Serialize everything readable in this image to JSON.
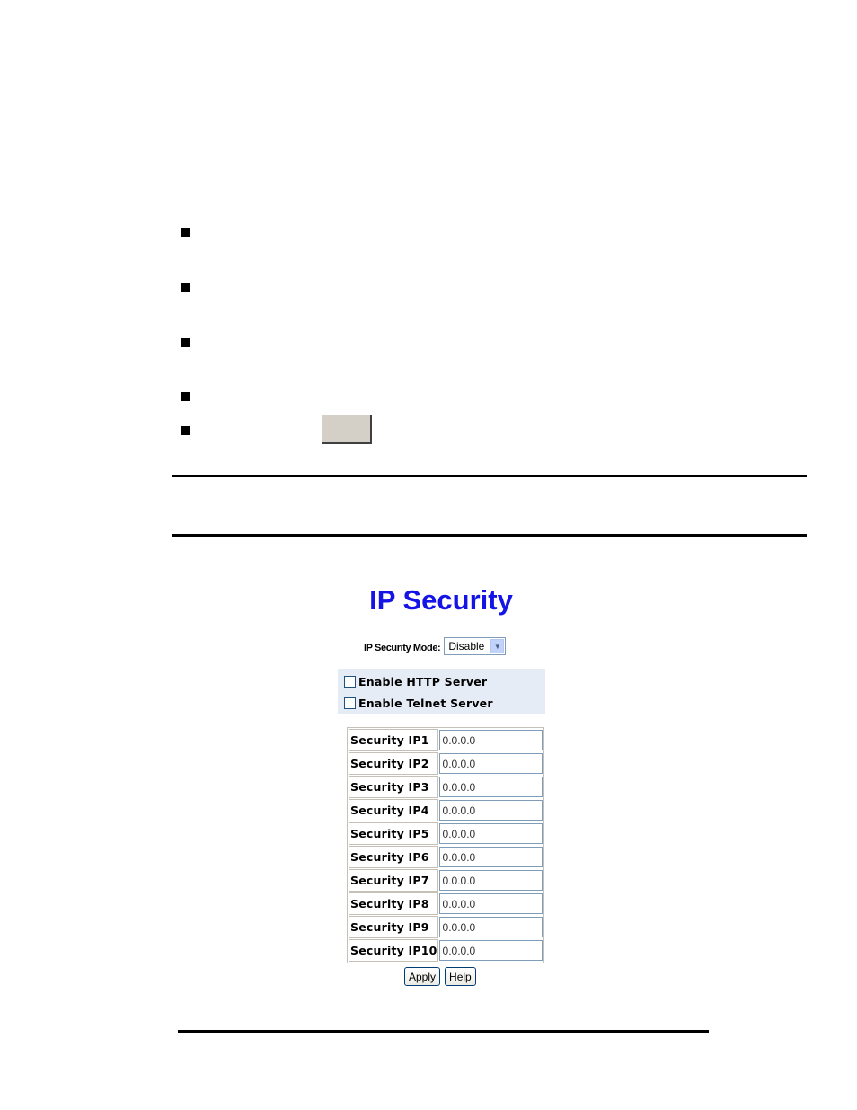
{
  "document": {
    "bullet_count": 5,
    "inline_button": {
      "label": ""
    }
  },
  "panel": {
    "title": "IP Security",
    "mode": {
      "label": "IP Security Mode:",
      "selected": "Disable",
      "icon": "chevron-down-icon"
    },
    "services": [
      {
        "label": "Enable HTTP Server",
        "checked": false
      },
      {
        "label": "Enable Telnet Server",
        "checked": false
      }
    ],
    "security_ips": [
      {
        "label": "Security IP1",
        "value": "0.0.0.0"
      },
      {
        "label": "Security IP2",
        "value": "0.0.0.0"
      },
      {
        "label": "Security IP3",
        "value": "0.0.0.0"
      },
      {
        "label": "Security IP4",
        "value": "0.0.0.0"
      },
      {
        "label": "Security IP5",
        "value": "0.0.0.0"
      },
      {
        "label": "Security IP6",
        "value": "0.0.0.0"
      },
      {
        "label": "Security IP7",
        "value": "0.0.0.0"
      },
      {
        "label": "Security IP8",
        "value": "0.0.0.0"
      },
      {
        "label": "Security IP9",
        "value": "0.0.0.0"
      },
      {
        "label": "Security IP10",
        "value": "0.0.0.0"
      }
    ],
    "buttons": {
      "apply": "Apply",
      "help": "Help"
    }
  },
  "colors": {
    "title": "#1414e6",
    "services_background": "#e6ecf5",
    "button_gray": "#d4d0c8"
  }
}
